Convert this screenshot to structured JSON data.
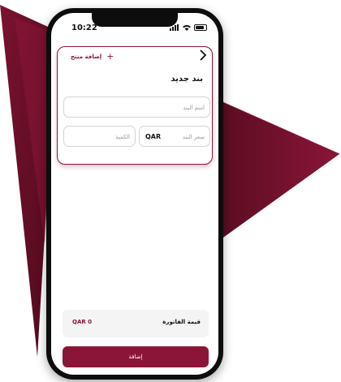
{
  "status_bar": {
    "time": "10:22"
  },
  "header": {
    "add_product_label": "إضافة منتج",
    "plus_icon": "+"
  },
  "form": {
    "title": "بند جديد",
    "name_placeholder": "اسم البند",
    "price_placeholder": "سعر البند",
    "currency": "QAR",
    "quantity_placeholder": "الكمية"
  },
  "footer": {
    "total_label": "قيمة الفاتورة",
    "total_value": "QAR 0",
    "submit_label": "إضافة"
  },
  "colors": {
    "brand": "#8a1538",
    "brand_dark": "#5e0f25"
  }
}
